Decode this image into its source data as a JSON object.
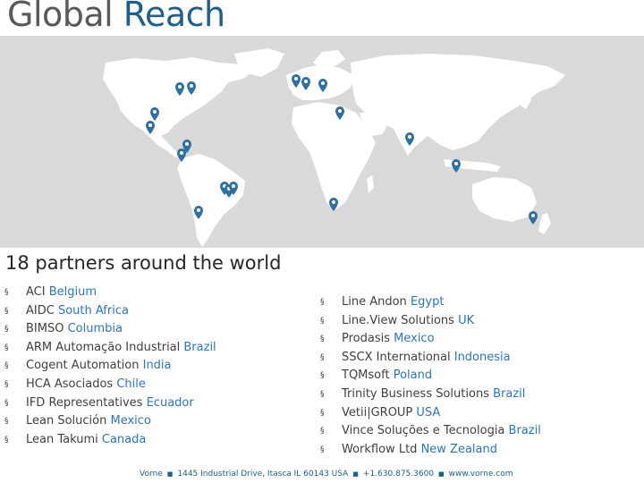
{
  "header": {
    "title_plain": "Global ",
    "title_accent": "Reach"
  },
  "map": {
    "land_color": "#ffffff",
    "ocean_color": "#d9d9d9",
    "pin_color": "#2f6fa3",
    "pin_icon": "map-pin-icon"
  },
  "subtitle": "18 partners around the world",
  "partners_left": [
    {
      "name": "ACI ",
      "country": "Belgium"
    },
    {
      "name": "AIDC ",
      "country": "South Africa"
    },
    {
      "name": "BIMSO ",
      "country": "Columbia"
    },
    {
      "name": "ARM Automação Industrial ",
      "country": "Brazil"
    },
    {
      "name": "Cogent Automation ",
      "country": "India"
    },
    {
      "name": "HCA Asociados ",
      "country": "Chile"
    },
    {
      "name": "IFD Representatives ",
      "country": "Ecuador"
    },
    {
      "name": "Lean Solución ",
      "country": "Mexico"
    },
    {
      "name": "Lean Takumi ",
      "country": "Canada"
    }
  ],
  "partners_right": [
    {
      "name": "Line Andon ",
      "country": "Egypt"
    },
    {
      "name": "Line.View Solutions ",
      "country": "UK"
    },
    {
      "name": "Prodasis ",
      "country": "Mexico"
    },
    {
      "name": "SSCX International ",
      "country": "Indonesia"
    },
    {
      "name": "TQMsoft ",
      "country": "Poland"
    },
    {
      "name": "Trinity Business Solutions ",
      "country": "Brazil"
    },
    {
      "name": "Vetii|GROUP ",
      "country": "USA"
    },
    {
      "name": "Vince Soluções e Tecnologia ",
      "country": "Brazil"
    },
    {
      "name": "Workflow Ltd ",
      "country": "New Zealand"
    }
  ],
  "bullet": "§",
  "footer": {
    "company": "Vorne",
    "address": "1445 Industrial Drive, Itasca IL 60143 USA",
    "phone": "+1.630.875.3600",
    "website": "www.vorne.com",
    "separator": "■"
  }
}
